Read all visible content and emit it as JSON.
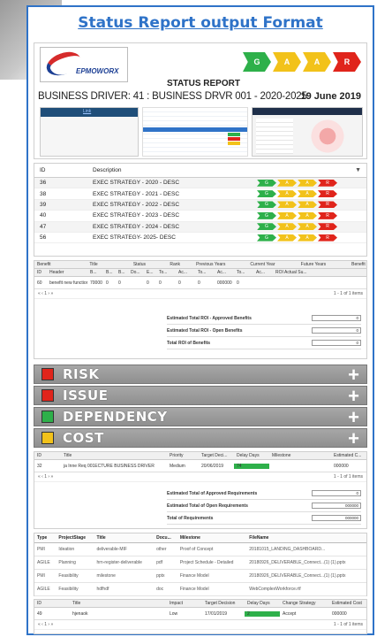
{
  "page_title": "Status Report output Format",
  "header": {
    "logo_text": "EPMOWORX",
    "status_title": "STATUS REPORT",
    "business_driver": "BUSINESS DRIVER: 41 : BUSINESS DRVR 001 - 2020-2025",
    "date": "19 June 2019",
    "rag": [
      {
        "letter": "G",
        "color": "#2eb04a"
      },
      {
        "letter": "A",
        "color": "#f2c21a"
      },
      {
        "letter": "A",
        "color": "#f2c21a"
      },
      {
        "letter": "R",
        "color": "#e0241b"
      }
    ],
    "mini_tab_label": "Link",
    "tolerance_label": "TOLERANCE"
  },
  "strategy": {
    "columns": [
      "ID",
      "Description"
    ],
    "rows": [
      {
        "id": "36",
        "desc": "EXEC STRATEGY - 2020 - DESC"
      },
      {
        "id": "38",
        "desc": "EXEC STRATEGY - 2021 - DESC"
      },
      {
        "id": "39",
        "desc": "EXEC STRATEGY - 2022 - DESC"
      },
      {
        "id": "40",
        "desc": "EXEC STRATEGY - 2023 - DESC"
      },
      {
        "id": "47",
        "desc": "EXEC STRATEGY - 2024 - DESC"
      },
      {
        "id": "56",
        "desc": "EXEC STRATEGY- 2025- DESC"
      }
    ],
    "filter_icon": "funnel-icon"
  },
  "benefit": {
    "group_headers": [
      "Benefit",
      "Title",
      "Status",
      "Rank",
      "Previous Years",
      "Current Year",
      "Future Years",
      "Benefit"
    ],
    "headers": [
      "ID",
      "Header",
      "B...",
      "B...",
      "B...",
      "Do...",
      "E...",
      "To...",
      "Ac...",
      "To...",
      "Ac...",
      "To...",
      "Ac...",
      "ROI Actual Su..."
    ],
    "row": [
      "60",
      "benefit new function for dashboard",
      "70000",
      "0",
      "0",
      "",
      "0",
      "0",
      "0",
      "0",
      "000000",
      "0",
      "",
      ""
    ],
    "pager_left": "« ‹ 1 › »",
    "pager_right": "1 - 1 of 1 items",
    "summary": [
      {
        "label": "Estimated Total ROI - Approved Benefits",
        "value": "0"
      },
      {
        "label": "Estimated Total ROI - Open Benefits",
        "value": "0"
      },
      {
        "label": "Total ROI of Benefits",
        "value": "0"
      }
    ]
  },
  "categories": [
    {
      "label": "RISK",
      "color": "#e0241b"
    },
    {
      "label": "ISSUE",
      "color": "#e0241b"
    },
    {
      "label": "DEPENDENCY",
      "color": "#2eb04a"
    },
    {
      "label": "COST",
      "color": "#f2c21a"
    }
  ],
  "requirements": {
    "headers": [
      "ID",
      "Title",
      "Priority",
      "Target Deci...",
      "Delay Days",
      "Milestone",
      "Estimated C..."
    ],
    "row": [
      "32",
      "ja Inne Req 001ECTURE BUSINESS DRIVER",
      "Medium",
      "20/06/2019",
      "74",
      "",
      "000000"
    ],
    "pager_left": "« ‹ 1 › »",
    "pager_right": "1 - 1 of 1 items",
    "summary": [
      {
        "label": "Estimated Total of Approved Requirements",
        "value": "0"
      },
      {
        "label": "Estimated Total of Open Requirements",
        "value": "000000"
      },
      {
        "label": "Total of Requirements",
        "value": "000000"
      }
    ]
  },
  "documents": {
    "headers": [
      "Type",
      "ProjectStage",
      "Title",
      "Docu...",
      "Milestone",
      "FileName"
    ],
    "rows": [
      [
        "PMI",
        "Ideation",
        "deliverable-MIF",
        "other",
        "Proof of Concept",
        "20181015_LANDING_DASHBOARD..."
      ],
      [
        "AGILE",
        "Planning",
        "hrn-register-deliverable",
        "pdf",
        "Project Schedule - Detailed",
        "20180926_DELIVERABLE_Connect...(1) (1).pptx"
      ],
      [
        "PMI",
        "Feasibility",
        "milestone",
        "pptx",
        "Finance Model",
        "20180926_DELIVERABLE_Connect...(1) (1).pptx"
      ],
      [
        "AGILE",
        "Feasibility",
        "hdfhdf",
        "doc",
        "Finance Model",
        "WebComplexWorkforce.rtf"
      ]
    ]
  },
  "changes": {
    "headers": [
      "ID",
      "Title",
      "Impact",
      "Target Decision",
      "Delay Days",
      "Change Strategy",
      "Estimated Cost"
    ],
    "row": [
      "49",
      "hjenaok",
      "Low",
      "17/01/2019",
      "2",
      "Accept",
      "000000"
    ],
    "pager_left": "« ‹ 1 › »",
    "pager_right": "1 - 1 of 1 items",
    "summary": [
      {
        "label": "Estimated Total Of Approved Changes",
        "value": ""
      },
      {
        "label": "Estimated Total Of Open Changes",
        "value": ""
      },
      {
        "label": "Total of Changes",
        "value": "000000"
      }
    ]
  }
}
